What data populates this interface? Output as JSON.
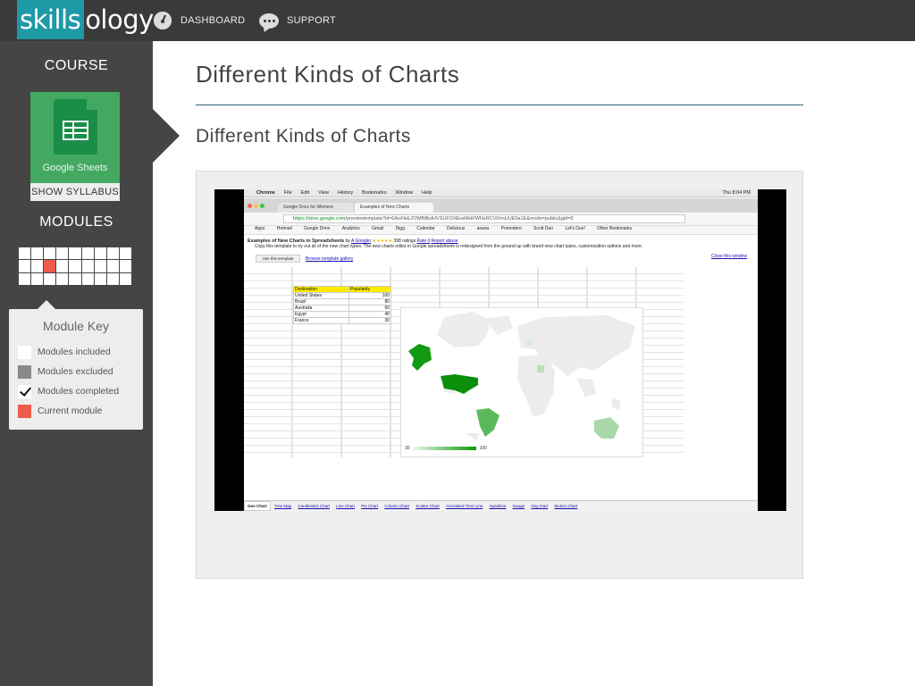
{
  "header": {
    "logo_highlight": "skills",
    "logo_rest": "ology",
    "nav": [
      {
        "label": "DASHBOARD",
        "icon": "dashboard-gauge-icon"
      },
      {
        "label": "SUPPORT",
        "icon": "speech-bubble-icon"
      }
    ]
  },
  "sidebar": {
    "course_label": "COURSE",
    "course_name": "Google Sheets",
    "syllabus_label": "SHOW SYLLABUS",
    "modules_label": "MODULES",
    "module_key": {
      "title": "Module Key",
      "items": [
        {
          "label": "Modules included",
          "swatch": "#ffffff"
        },
        {
          "label": "Modules excluded",
          "swatch": "#8a8a8a"
        },
        {
          "label": "Modules completed",
          "swatch": "checkmark"
        },
        {
          "label": "Current module",
          "swatch": "#ef5b4c"
        }
      ]
    }
  },
  "main": {
    "page_title": "Different Kinds of Charts",
    "lesson_title": "Different Kinds of Charts"
  },
  "screencast": {
    "menu": [
      "Chrome",
      "File",
      "Edit",
      "View",
      "History",
      "Bookmarks",
      "Window",
      "Help"
    ],
    "clock": "Thu 8:04 PM",
    "tabs": [
      "Google Docs for Winners",
      "Examples of New Charts"
    ],
    "url_host": "https://drive.google.com",
    "url_path": "/previewtemplate?id=0AoFkkLP2MB8kdHVSUFI1NEwtNHFWNzRCVlVmUUE0a1E&mode=public&gid=9",
    "bookmarks": [
      "Apps",
      "Hotmail",
      "Google Drive",
      "Analytics",
      "Gmail",
      "Digg",
      "Calendar",
      "Delicious",
      "asana",
      "Pomodoro",
      "Scott Duo",
      "Let's Duo!",
      "Other Bookmarks"
    ],
    "template_title": "Examples of New Charts in Spreadsheets",
    "template_by": "by",
    "template_author": "A Googler",
    "template_ratings": "398 ratings",
    "rate_link": "Rate it",
    "report_link": "Report abuse",
    "template_desc": "Copy this template to try out all of the new chart types. The new charts editor in Google spreadsheets is redesigned from the ground up with brand new chart types, customization options and more.",
    "use_button": "Use this template",
    "browse_link": "Browse template gallery",
    "close_link": "Close this window",
    "table_headers": [
      "Destination",
      "Popularity"
    ],
    "table_rows": [
      [
        "United States",
        "100"
      ],
      [
        "Brazil",
        "80"
      ],
      [
        "Australia",
        "60"
      ],
      [
        "Egypt",
        "40"
      ],
      [
        "France",
        "30"
      ]
    ],
    "legend_min": "30",
    "legend_max": "100",
    "sheet_tabs": [
      "Geo Chart",
      "Tree Map",
      "Candlestick Chart",
      "Line Chart",
      "Pie Chart",
      "Column Chart",
      "Scatter Chart",
      "Annotated Time Line",
      "Sparkline",
      "Gauge",
      "Org chart",
      "Motion Chart"
    ]
  },
  "colors": {
    "brand_teal": "#1e99a6",
    "current_module": "#ef5b4c",
    "sheets_green": "#43a860"
  }
}
